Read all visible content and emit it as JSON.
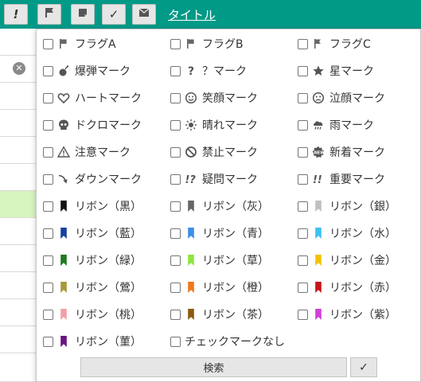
{
  "toolbar": {
    "buttons": [
      {
        "icon": "exclamation-icon",
        "glyph": "!"
      },
      {
        "icon": "flag-icon",
        "glyph": ""
      },
      {
        "icon": "note-icon",
        "glyph": ""
      },
      {
        "icon": "checkmark-icon",
        "glyph": "✓"
      },
      {
        "icon": "mail-icon",
        "glyph": ""
      }
    ],
    "title_link": "タイトル"
  },
  "panel": {
    "rows": [
      [
        {
          "label": "フラグA",
          "icon": "flag-icon",
          "color": "#666666"
        },
        {
          "label": "フラグB",
          "icon": "flag-icon",
          "color": "#666666"
        },
        {
          "label": "フラグC",
          "icon": "flag-outline-icon",
          "color": "#666666"
        }
      ],
      [
        {
          "label": "爆弾マーク",
          "icon": "bomb-icon",
          "color": "#555555"
        },
        {
          "label": "？マーク",
          "icon": "question-icon",
          "color": "#555555"
        },
        {
          "label": "星マーク",
          "icon": "star-icon",
          "color": "#555555"
        }
      ],
      [
        {
          "label": "ハートマーク",
          "icon": "heart-icon",
          "color": "#555555"
        },
        {
          "label": "笑顔マーク",
          "icon": "smile-icon",
          "color": "#555555"
        },
        {
          "label": "泣顔マーク",
          "icon": "sad-face-icon",
          "color": "#555555"
        }
      ],
      [
        {
          "label": "ドクロマーク",
          "icon": "skull-icon",
          "color": "#555555"
        },
        {
          "label": "晴れマーク",
          "icon": "sun-icon",
          "color": "#555555"
        },
        {
          "label": "雨マーク",
          "icon": "rain-icon",
          "color": "#555555"
        }
      ],
      [
        {
          "label": "注意マーク",
          "icon": "warning-icon",
          "color": "#555555"
        },
        {
          "label": "禁止マーク",
          "icon": "prohibited-icon",
          "color": "#555555"
        },
        {
          "label": "新着マーク",
          "icon": "new-badge-icon",
          "color": "#555555"
        }
      ],
      [
        {
          "label": "ダウンマーク",
          "icon": "down-arrow-icon",
          "color": "#555555"
        },
        {
          "label": "疑問マーク",
          "icon": "interrobang-icon",
          "color": "#555555"
        },
        {
          "label": "重要マーク",
          "icon": "double-exclamation-icon",
          "color": "#555555"
        }
      ],
      [
        {
          "label": "リボン（黒）",
          "icon": "ribbon-icon",
          "color": "#111111"
        },
        {
          "label": "リボン（灰）",
          "icon": "ribbon-icon",
          "color": "#666666"
        },
        {
          "label": "リボン（銀）",
          "icon": "ribbon-icon",
          "color": "#c0c0c0"
        }
      ],
      [
        {
          "label": "リボン（藍）",
          "icon": "ribbon-icon",
          "color": "#1440a0"
        },
        {
          "label": "リボン（青）",
          "icon": "ribbon-icon",
          "color": "#3d8ee8"
        },
        {
          "label": "リボン（水）",
          "icon": "ribbon-icon",
          "color": "#3fc0f0"
        }
      ],
      [
        {
          "label": "リボン（緑）",
          "icon": "ribbon-icon",
          "color": "#1f7a1f"
        },
        {
          "label": "リボン（草）",
          "icon": "ribbon-icon",
          "color": "#8ee63c"
        },
        {
          "label": "リボン（金）",
          "icon": "ribbon-icon",
          "color": "#f2c300"
        }
      ],
      [
        {
          "label": "リボン（鶯）",
          "icon": "ribbon-icon",
          "color": "#a89a3a"
        },
        {
          "label": "リボン（橙）",
          "icon": "ribbon-icon",
          "color": "#f07818"
        },
        {
          "label": "リボン（赤）",
          "icon": "ribbon-icon",
          "color": "#c81414"
        }
      ],
      [
        {
          "label": "リボン（桃）",
          "icon": "ribbon-icon",
          "color": "#f2a0a8"
        },
        {
          "label": "リボン（茶）",
          "icon": "ribbon-icon",
          "color": "#8a5a10"
        },
        {
          "label": "リボン（紫）",
          "icon": "ribbon-icon",
          "color": "#d040d8"
        }
      ],
      [
        {
          "label": "リボン（菫）",
          "icon": "ribbon-icon",
          "color": "#6a1480"
        },
        {
          "label": "チェックマークなし",
          "icon": "",
          "color": ""
        }
      ]
    ],
    "search_label": "検索",
    "confirm_label": "✓"
  },
  "background_table": {
    "clear_icon_glyph": "✕"
  }
}
